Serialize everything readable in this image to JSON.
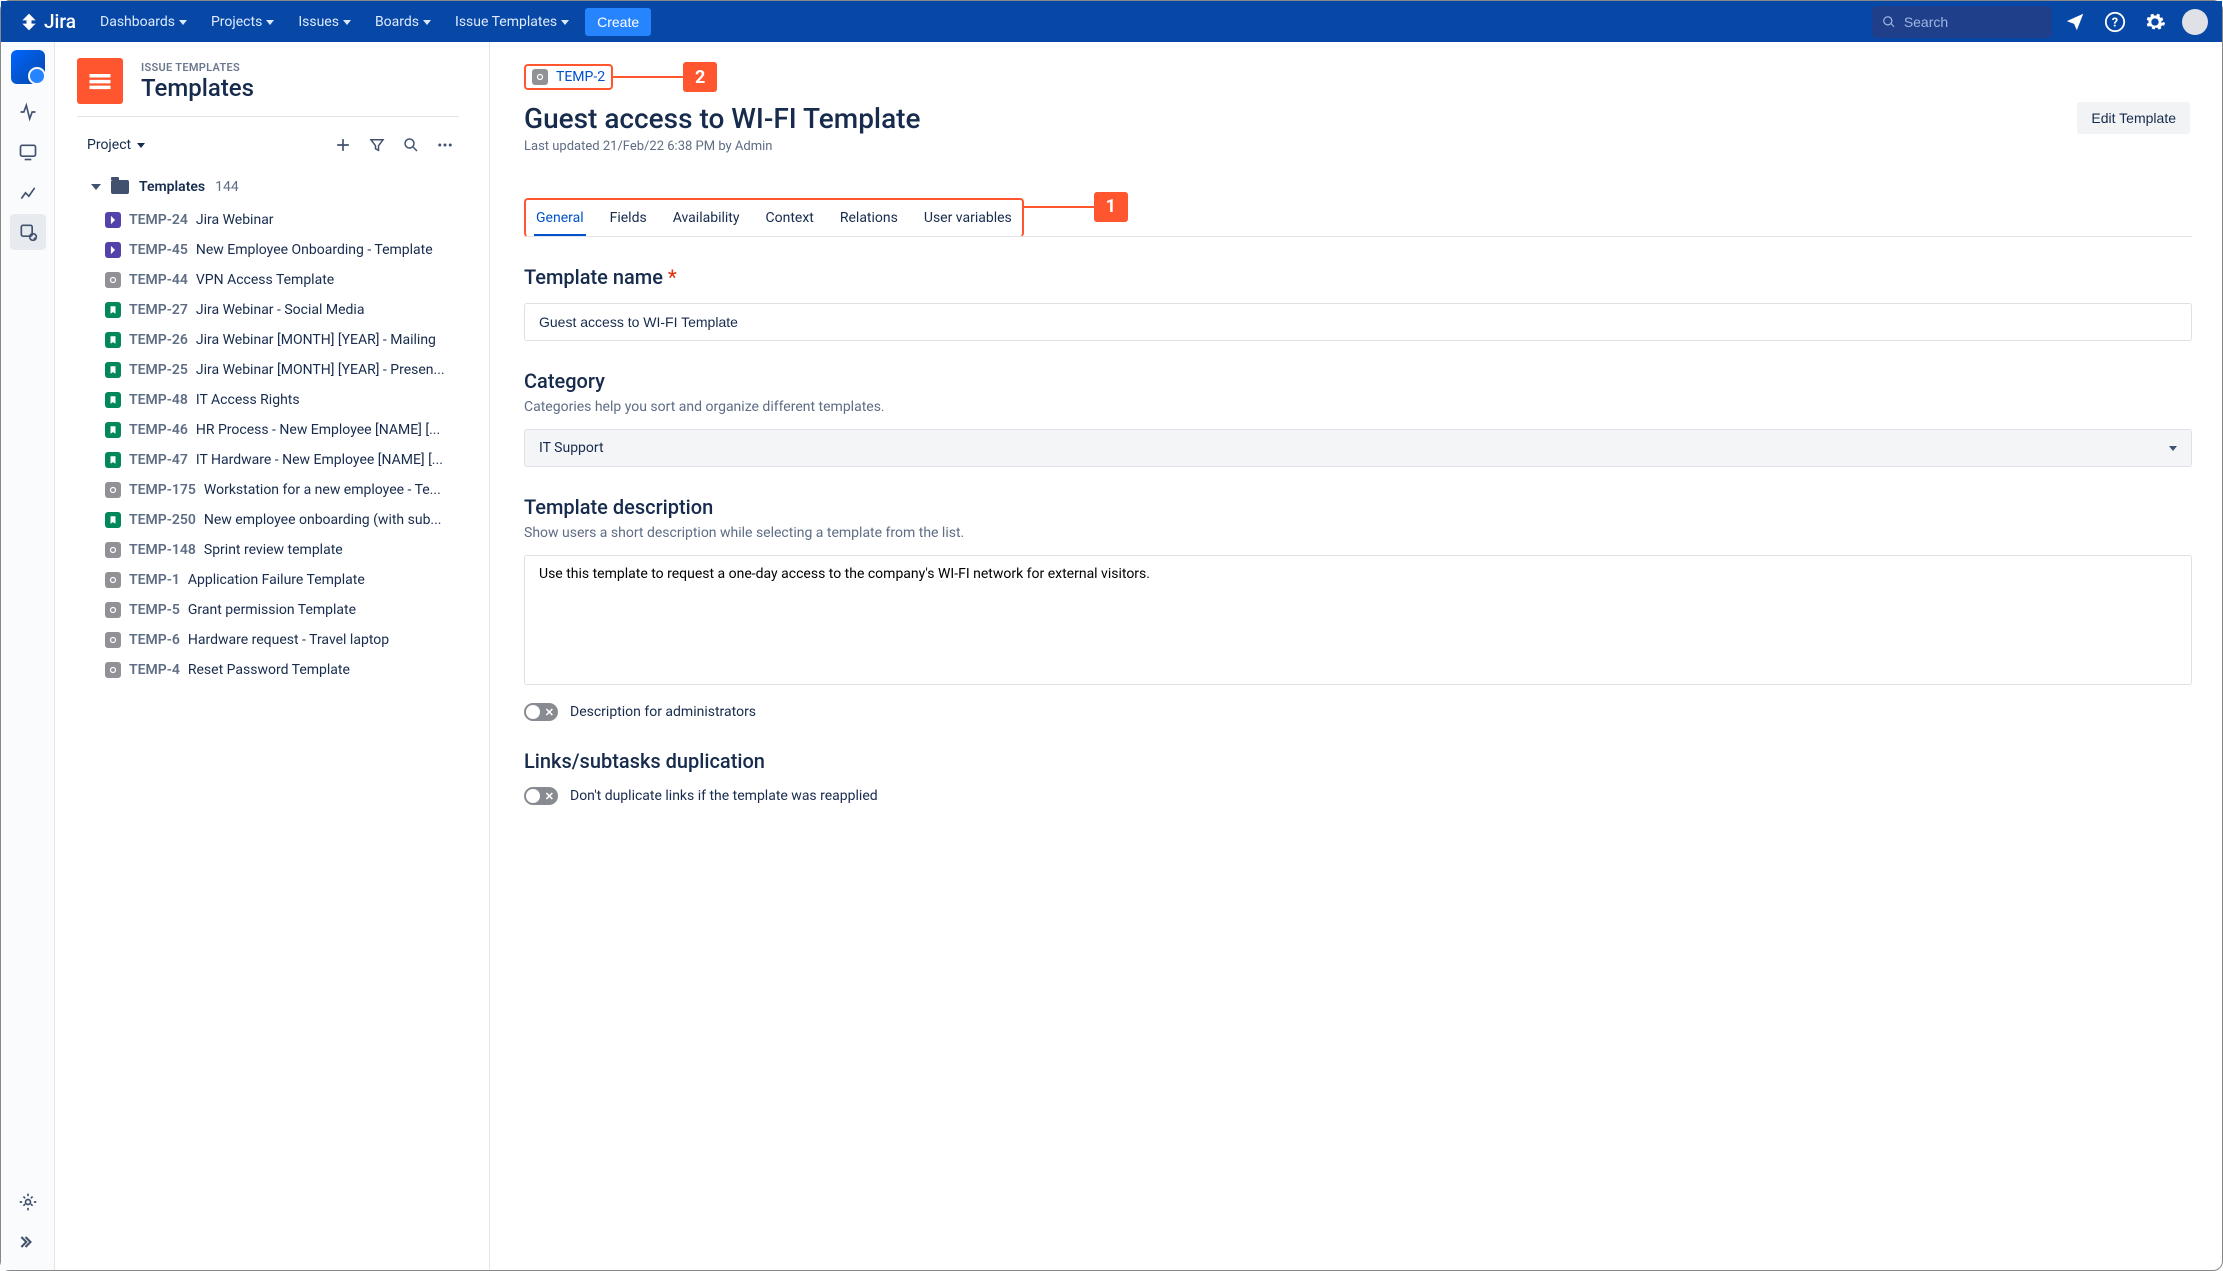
{
  "topnav": {
    "brand": "Jira",
    "links": [
      "Dashboards",
      "Projects",
      "Issues",
      "Boards",
      "Issue Templates"
    ],
    "create": "Create",
    "search_placeholder": "Search"
  },
  "sidebar": {
    "breadcrumb_small": "ISSUE TEMPLATES",
    "title": "Templates",
    "scope_label": "Project",
    "tree_label": "Templates",
    "tree_count": "144",
    "items": [
      {
        "type": "purple",
        "key": "TEMP-24",
        "title": "Jira Webinar"
      },
      {
        "type": "purple",
        "key": "TEMP-45",
        "title": "New Employee Onboarding - Template"
      },
      {
        "type": "grey",
        "key": "TEMP-44",
        "title": "VPN Access Template"
      },
      {
        "type": "green",
        "key": "TEMP-27",
        "title": "Jira Webinar - Social Media"
      },
      {
        "type": "green",
        "key": "TEMP-26",
        "title": "Jira Webinar [MONTH] [YEAR] - Mailing"
      },
      {
        "type": "green",
        "key": "TEMP-25",
        "title": "Jira Webinar [MONTH] [YEAR] - Presen..."
      },
      {
        "type": "green",
        "key": "TEMP-48",
        "title": "IT Access Rights"
      },
      {
        "type": "green",
        "key": "TEMP-46",
        "title": "HR Process - New Employee [NAME] [..."
      },
      {
        "type": "green",
        "key": "TEMP-47",
        "title": "IT Hardware - New Employee [NAME] [..."
      },
      {
        "type": "grey",
        "key": "TEMP-175",
        "title": "Workstation for a new employee - Te..."
      },
      {
        "type": "green",
        "key": "TEMP-250",
        "title": "New employee onboarding (with sub..."
      },
      {
        "type": "grey",
        "key": "TEMP-148",
        "title": "Sprint review template"
      },
      {
        "type": "grey",
        "key": "TEMP-1",
        "title": "Application Failure Template"
      },
      {
        "type": "grey",
        "key": "TEMP-5",
        "title": "Grant permission Template"
      },
      {
        "type": "grey",
        "key": "TEMP-6",
        "title": "Hardware request - Travel laptop"
      },
      {
        "type": "grey",
        "key": "TEMP-4",
        "title": "Reset Password Template"
      }
    ]
  },
  "main": {
    "template_key": "TEMP-2",
    "title": "Guest access to WI-FI Template",
    "updated": "Last updated 21/Feb/22 6:38 PM by Admin",
    "edit_btn": "Edit Template",
    "tabs": [
      "General",
      "Fields",
      "Availability",
      "Context",
      "Relations",
      "User variables"
    ],
    "active_tab": 0,
    "sections": {
      "name_label": "Template name",
      "name_value": "Guest access to WI-FI Template",
      "category_label": "Category",
      "category_hint": "Categories help you sort and organize different templates.",
      "category_value": "IT Support",
      "desc_label": "Template description",
      "desc_hint": "Show users a short description while selecting a template from the list.",
      "desc_value": "Use this template to request a one-day access to the company's WI-FI network for external visitors.",
      "toggle_admin_desc": "Description for administrators",
      "links_label": "Links/subtasks duplication",
      "toggle_nodup": "Don't duplicate links if the template was reapplied"
    },
    "callouts": {
      "top": "2",
      "tabs": "1"
    }
  }
}
